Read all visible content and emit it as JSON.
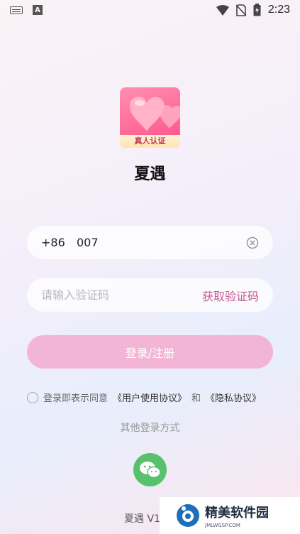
{
  "status_bar": {
    "time": "2:23",
    "icons": [
      "keyboard-icon",
      "a-icon",
      "wifi-icon",
      "no-sim-icon",
      "battery-icon"
    ]
  },
  "app": {
    "name": "夏遇",
    "logo_tag": "真人认证"
  },
  "phone": {
    "country_code": "+86",
    "value": "007"
  },
  "code": {
    "placeholder": "请输入验证码",
    "get_code_label": "获取验证码"
  },
  "login_label": "登录/注册",
  "agreement": {
    "prefix": "登录即表示同意",
    "user_agreement": "《用户使用协议》",
    "and": "和",
    "privacy": "《隐私协议》"
  },
  "other_login_title": "其他登录方式",
  "version": "夏遇 V1",
  "watermark": {
    "title": "精美软件园",
    "subtitle": "JMLWGSP.COM"
  },
  "colors": {
    "accent": "#c65c93",
    "login_button": "#f2b5d6",
    "wechat": "#58c16d"
  }
}
